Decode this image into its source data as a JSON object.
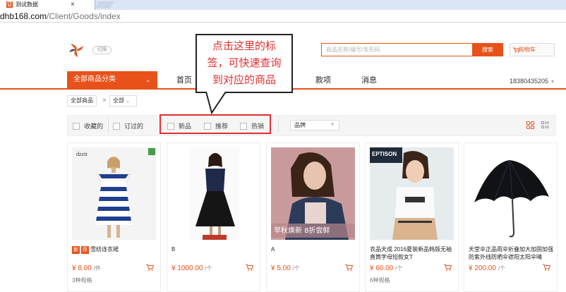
{
  "browser": {
    "tab_title": "测试数据",
    "tab_close": "×",
    "favicon_text": "订",
    "address_host": "dhb168.com",
    "address_path": "/Client/Goods/index"
  },
  "header": {
    "switch_label": "切换",
    "search_placeholder": "商品名称/编号/条形码",
    "search_button": "搜索",
    "cart_label": "购物车"
  },
  "nav": {
    "category_menu": "全部商品分类",
    "items": [
      "首页",
      "款项",
      "消息"
    ],
    "user_phone": "18380435205",
    "user_caret": "▼"
  },
  "breadcrumb": {
    "root": "全部商品",
    "separator": ">",
    "current": "全部"
  },
  "filters": {
    "options": [
      "收藏的",
      "订过的",
      "新品",
      "推荐",
      "热销"
    ],
    "brand_label": "品牌"
  },
  "callout": {
    "lines": [
      "点击这里的标",
      "签，可快速查询",
      "到对应的商品"
    ]
  },
  "products": [
    {
      "name": "雪纺连衣裙",
      "tags": [
        "新",
        "荐"
      ],
      "price": "¥ 8.00",
      "unit": "/件",
      "spec": "3种规格",
      "img_text": "dzzit",
      "img_bg": "#f2f2f2"
    },
    {
      "name": "B",
      "tags": [],
      "price": "¥ 1000.00",
      "unit": "/个",
      "spec": "",
      "img_text": "",
      "img_bg": "#ffffff"
    },
    {
      "name": "A",
      "tags": [],
      "price": "¥ 5.00",
      "unit": "/个",
      "spec": "",
      "img_text": "早秋焕新 8折尝鲜",
      "img_bg": "#c9a0a2"
    },
    {
      "name": "衣品天成 2016夏装新品韩版无袖直筒字母短款女T",
      "tags": [],
      "price": "¥ 60.00",
      "unit": "/个",
      "spec": "6种规格",
      "img_text": "EPTISON",
      "img_bg": "#e9eef2"
    },
    {
      "name": "天堂伞正品雨伞折叠加大加固加强防紫外线防晒伞遮阳太阳伞晴",
      "tags": [],
      "price": "¥ 200.00",
      "unit": "/个",
      "spec": "",
      "img_text": "",
      "img_bg": "#ffffff"
    }
  ],
  "colors": {
    "accent": "#e8521a",
    "callout_text": "#e03030",
    "highlight_border": "#e03030"
  }
}
